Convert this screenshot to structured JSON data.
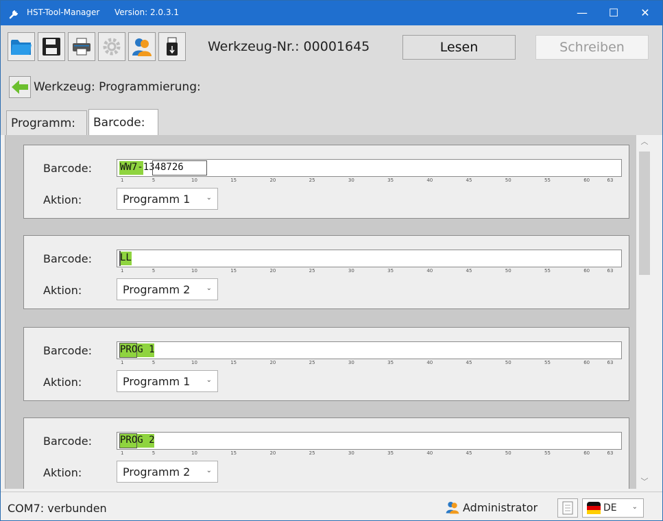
{
  "window": {
    "title": "HST-Tool-Manager",
    "version": "Version: 2.0.3.1",
    "title_color": "#1f6fcf"
  },
  "toolbar": {
    "icons": [
      "folder-icon",
      "save-icon",
      "printer-icon",
      "settings-icon",
      "user-icon",
      "usb-stick-icon"
    ],
    "tool_number": "Werkzeug-Nr.: 00001645",
    "read_label": "Lesen",
    "write_label": "Schreiben"
  },
  "header": {
    "title": "Werkzeug: Programmierung:"
  },
  "tabs": [
    {
      "label": "Programm:",
      "active": false
    },
    {
      "label": "Barcode:",
      "active": true
    }
  ],
  "barcodes": [
    {
      "label": "Barcode:",
      "value": "WW7-1348726",
      "highlight_chars": 4,
      "action_label": "Aktion:",
      "action": "Programm 1"
    },
    {
      "label": "Barcode:",
      "value": "LL",
      "highlight_chars": 2,
      "action_label": "Aktion:",
      "action": "Programm 2"
    },
    {
      "label": "Barcode:",
      "value": "PROG 1",
      "highlight_chars": 6,
      "action_label": "Aktion:",
      "action": "Programm 1"
    },
    {
      "label": "Barcode:",
      "value": "PROG 2",
      "highlight_chars": 6,
      "action_label": "Aktion:",
      "action": "Programm 2"
    }
  ],
  "ruler_ticks": [
    "1",
    "5",
    "10",
    "15",
    "20",
    "25",
    "30",
    "35",
    "40",
    "45",
    "50",
    "55",
    "60",
    "63"
  ],
  "status": {
    "connection": "COM7: verbunden",
    "user": "Administrator",
    "language": "DE"
  },
  "colors": {
    "highlight": "#8fd43f",
    "accent": "#1f6fcf"
  }
}
